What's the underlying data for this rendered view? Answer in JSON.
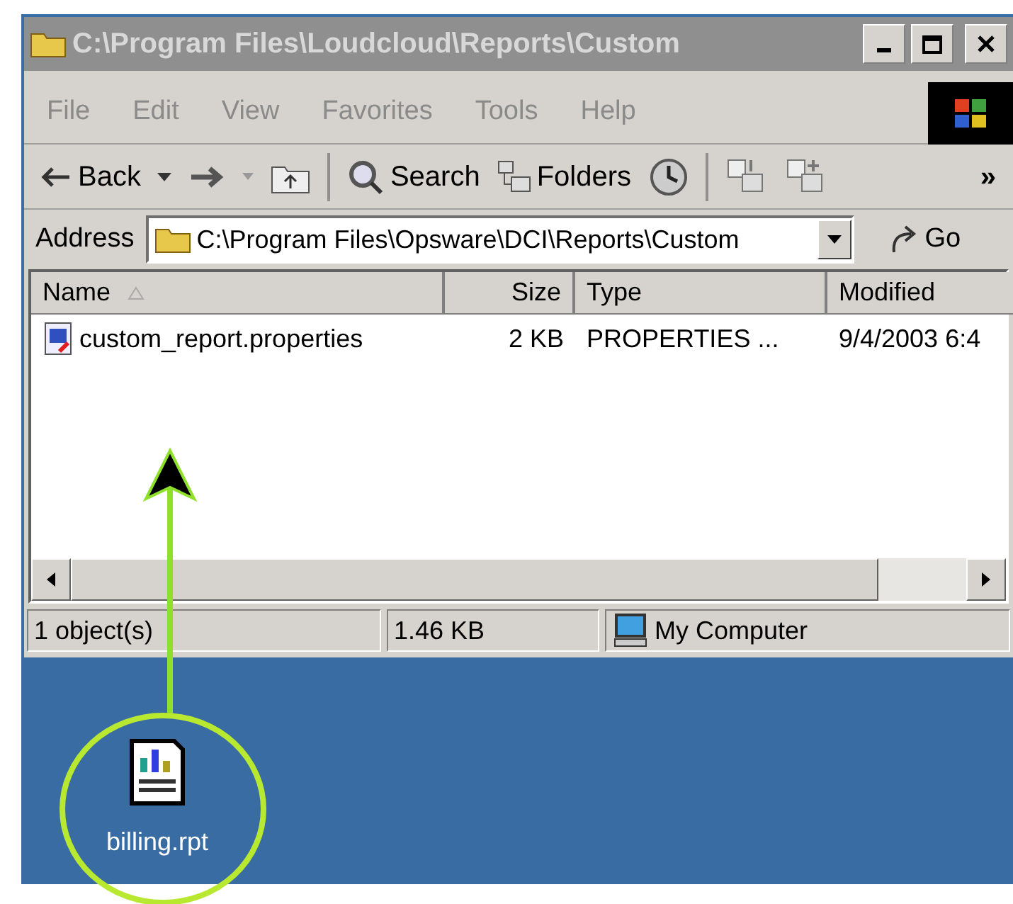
{
  "window": {
    "title": "C:\\Program Files\\Loudcloud\\Reports\\Custom",
    "active": false
  },
  "menu": [
    "File",
    "Edit",
    "View",
    "Favorites",
    "Tools",
    "Help"
  ],
  "toolbar": {
    "back": "Back",
    "search": "Search",
    "folders": "Folders",
    "more": "»"
  },
  "address": {
    "label": "Address",
    "value": "C:\\Program Files\\Opsware\\DCI\\Reports\\Custom",
    "go": "Go"
  },
  "table": {
    "columns": [
      {
        "label": "Name",
        "sorted": true
      },
      {
        "label": "Size",
        "sorted": false
      },
      {
        "label": "Type",
        "sorted": false
      },
      {
        "label": "Modified",
        "sorted": false
      }
    ],
    "rows": [
      {
        "name": "custom_report.properties",
        "size": "2 KB",
        "type": "PROPERTIES ...",
        "modified": "9/4/2003 6:4"
      }
    ]
  },
  "status_bar": [
    "1 object(s)",
    "1.46 KB",
    "My Computer"
  ],
  "desktop": {
    "icon_label": "billing.rpt"
  }
}
